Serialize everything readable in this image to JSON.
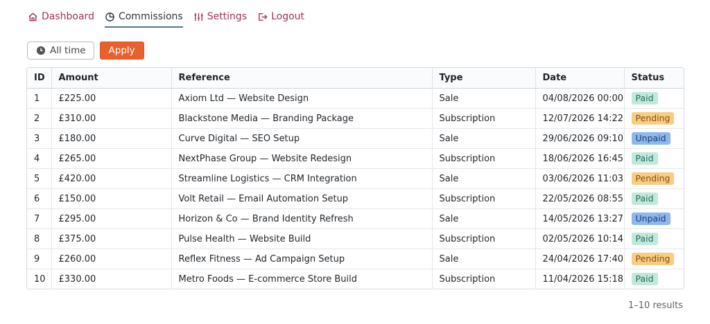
{
  "nav": [
    {
      "label": "Dashboard",
      "icon": "home-icon",
      "active": false
    },
    {
      "label": "Commissions",
      "icon": "pie-chart-icon",
      "active": true
    },
    {
      "label": "Settings",
      "icon": "sliders-icon",
      "active": false
    },
    {
      "label": "Logout",
      "icon": "logout-icon",
      "active": false
    }
  ],
  "filters": {
    "range_label": "All time",
    "apply_label": "Apply"
  },
  "table": {
    "columns": [
      "ID",
      "Amount",
      "Reference",
      "Type",
      "Date",
      "Status"
    ],
    "rows": [
      {
        "id": "1",
        "amount": "£225.00",
        "reference": "Axiom Ltd — Website Design",
        "type": "Sale",
        "date": "04/08/2026 00:00",
        "status": "Paid"
      },
      {
        "id": "2",
        "amount": "£310.00",
        "reference": "Blackstone Media — Branding Package",
        "type": "Subscription",
        "date": "12/07/2026 14:22",
        "status": "Pending"
      },
      {
        "id": "3",
        "amount": "£180.00",
        "reference": "Curve Digital — SEO Setup",
        "type": "Sale",
        "date": "29/06/2026 09:10",
        "status": "Unpaid"
      },
      {
        "id": "4",
        "amount": "£265.00",
        "reference": "NextPhase Group — Website Redesign",
        "type": "Subscription",
        "date": "18/06/2026 16:45",
        "status": "Paid"
      },
      {
        "id": "5",
        "amount": "£420.00",
        "reference": "Streamline Logistics — CRM Integration",
        "type": "Sale",
        "date": "03/06/2026 11:03",
        "status": "Pending"
      },
      {
        "id": "6",
        "amount": "£150.00",
        "reference": "Volt Retail — Email Automation Setup",
        "type": "Subscription",
        "date": "22/05/2026 08:55",
        "status": "Paid"
      },
      {
        "id": "7",
        "amount": "£295.00",
        "reference": "Horizon & Co — Brand Identity Refresh",
        "type": "Sale",
        "date": "14/05/2026 13:27",
        "status": "Unpaid"
      },
      {
        "id": "8",
        "amount": "£375.00",
        "reference": "Pulse Health — Website Build",
        "type": "Subscription",
        "date": "02/05/2026 10:14",
        "status": "Paid"
      },
      {
        "id": "9",
        "amount": "£260.00",
        "reference": "Reflex Fitness — Ad Campaign Setup",
        "type": "Sale",
        "date": "24/04/2026 17:40",
        "status": "Pending"
      },
      {
        "id": "10",
        "amount": "£330.00",
        "reference": "Metro Foods — E-commerce Store Build",
        "type": "Subscription",
        "date": "11/04/2026 15:18",
        "status": "Paid"
      }
    ]
  },
  "results_text": "1–10 results",
  "colors": {
    "nav_link": "#a3305f",
    "apply": "#e8612c",
    "paid": "#c2e8dc",
    "pending": "#f7cd84",
    "unpaid": "#8eb7ec"
  }
}
